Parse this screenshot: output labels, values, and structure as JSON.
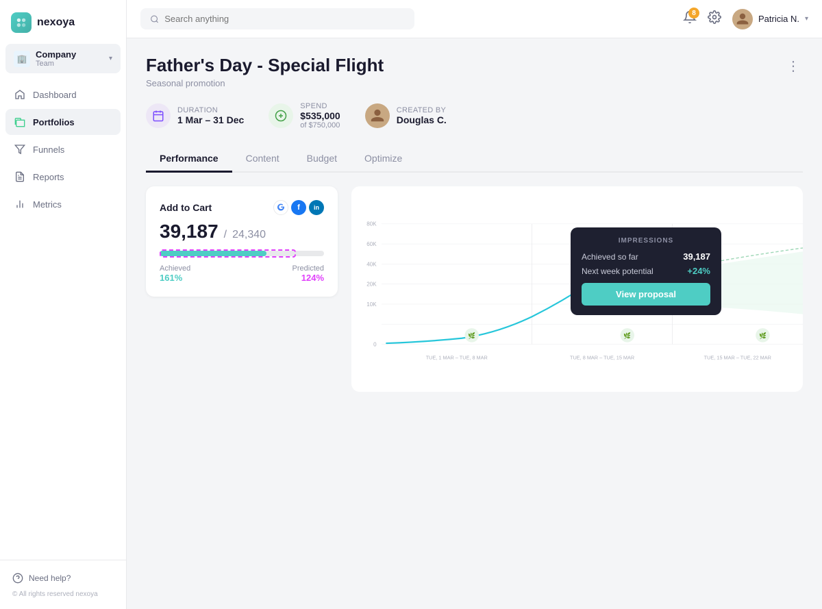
{
  "app": {
    "name": "nexoya",
    "logo_alt": "nexoya logo"
  },
  "team": {
    "name": "Company",
    "sub": "Team"
  },
  "nav": {
    "items": [
      {
        "id": "dashboard",
        "label": "Dashboard",
        "active": false
      },
      {
        "id": "portfolios",
        "label": "Portfolios",
        "active": true
      },
      {
        "id": "funnels",
        "label": "Funnels",
        "active": false
      },
      {
        "id": "reports",
        "label": "Reports",
        "active": false
      },
      {
        "id": "metrics",
        "label": "Metrics",
        "active": false
      }
    ]
  },
  "topbar": {
    "search_placeholder": "Search anything",
    "notifications_count": "8",
    "user_name": "Patricia N."
  },
  "campaign": {
    "title": "Father's Day - Special Flight",
    "subtitle": "Seasonal promotion",
    "duration_label": "Duration",
    "duration_value": "1 Mar – 31 Dec",
    "spend_label": "Spend",
    "spend_value": "$535,000",
    "spend_of": "of $750,000",
    "created_by_label": "Created by",
    "created_by_name": "Douglas C."
  },
  "tabs": [
    {
      "id": "performance",
      "label": "Performance",
      "active": true
    },
    {
      "id": "content",
      "label": "Content",
      "active": false
    },
    {
      "id": "budget",
      "label": "Budget",
      "active": false
    },
    {
      "id": "optimize",
      "label": "Optimize",
      "active": false
    }
  ],
  "metric_card": {
    "title": "Add to Cart",
    "main_number": "39,187",
    "separator": "/",
    "target_number": "24,340",
    "achieved_label": "Achieved",
    "achieved_value": "161%",
    "predicted_label": "Predicted",
    "predicted_value": "124%",
    "progress_achieved_pct": 65,
    "progress_predicted_pct": 85
  },
  "tooltip": {
    "title": "IMPRESSIONS",
    "achieved_label": "Achieved so far",
    "achieved_value": "39,187",
    "potential_label": "Next week potential",
    "potential_value": "+24%",
    "btn_label": "View proposal"
  },
  "chart": {
    "y_labels": [
      "80K",
      "60K",
      "40K",
      "20K",
      "10K",
      "0"
    ],
    "x_labels": [
      "TUE, 1 MAR – TUE, 8 MAR",
      "TUE, 8 MAR – TUE, 15 MAR",
      "TUE, 15 MAR – TUE, 22 MAR"
    ]
  },
  "footer": {
    "help_label": "Need help?",
    "copyright": "© All rights reserved nexoya"
  }
}
